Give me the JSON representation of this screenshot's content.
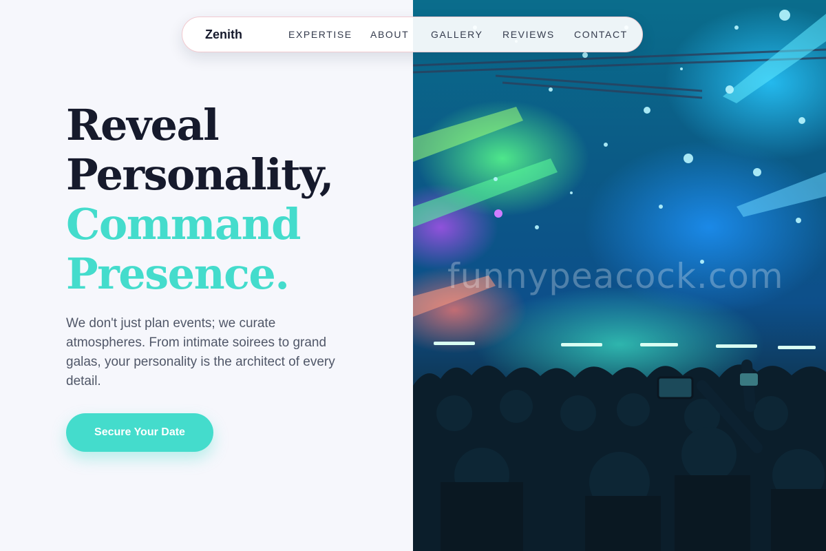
{
  "nav": {
    "brand": "Zenith",
    "links": [
      {
        "label": "EXPERTISE"
      },
      {
        "label": "ABOUT"
      },
      {
        "label": "GALLERY"
      },
      {
        "label": "REVIEWS"
      },
      {
        "label": "CONTACT"
      }
    ]
  },
  "hero": {
    "headline": {
      "line1": "Reveal",
      "line2": "Personality,",
      "line3": "Command",
      "line4": "Presence."
    },
    "lead": "We don't just plan events; we curate atmospheres. From intimate soirees to grand galas, your personality is the architect of every detail.",
    "cta_label": "Secure Your Date",
    "image_watermark": "funnypeacock.com"
  },
  "colors": {
    "accent": "#44dccc",
    "heading": "#161a2c",
    "body_text": "#505768",
    "background": "#f6f7fc"
  }
}
